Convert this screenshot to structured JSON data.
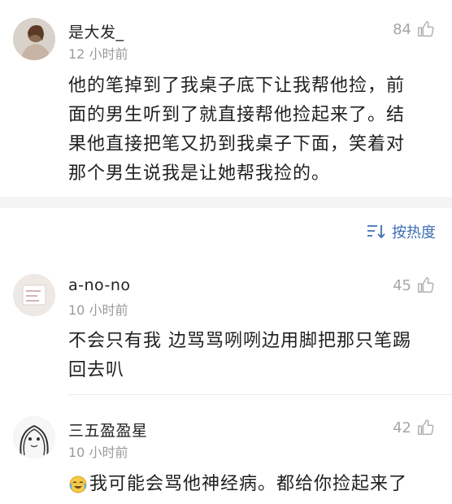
{
  "comments": [
    {
      "username": "是大发_",
      "time": "12 小时前",
      "likes": "84",
      "text_lines": [
        "他的笔掉到了我桌子底下让我帮他捡，前",
        "面的男生听到了就直接帮他捡起来了。结",
        "果他直接把笔又扔到我桌子下面，笑着对",
        "那个男生说我是让她帮我捡的。"
      ]
    },
    {
      "username": "a-no-no",
      "time": "10 小时前",
      "likes": "45",
      "text_lines": [
        "不会只有我 边骂骂咧咧边用脚把那只笔踢",
        "回去叭"
      ]
    },
    {
      "username": "三五盈盈星",
      "time": "10 小时前",
      "likes": "42",
      "text_lines": [
        "我可能会骂他神经病。都给你捡起来了"
      ]
    }
  ],
  "sort": {
    "label": "按热度",
    "icon": "sort-icon"
  },
  "icons": {
    "like": "thumbs-up-icon",
    "emoji": "laughing-crying-emoji"
  },
  "colors": {
    "accent": "#3c6eb4",
    "muted": "#9a9a9a",
    "band": "#f4f4f4"
  }
}
